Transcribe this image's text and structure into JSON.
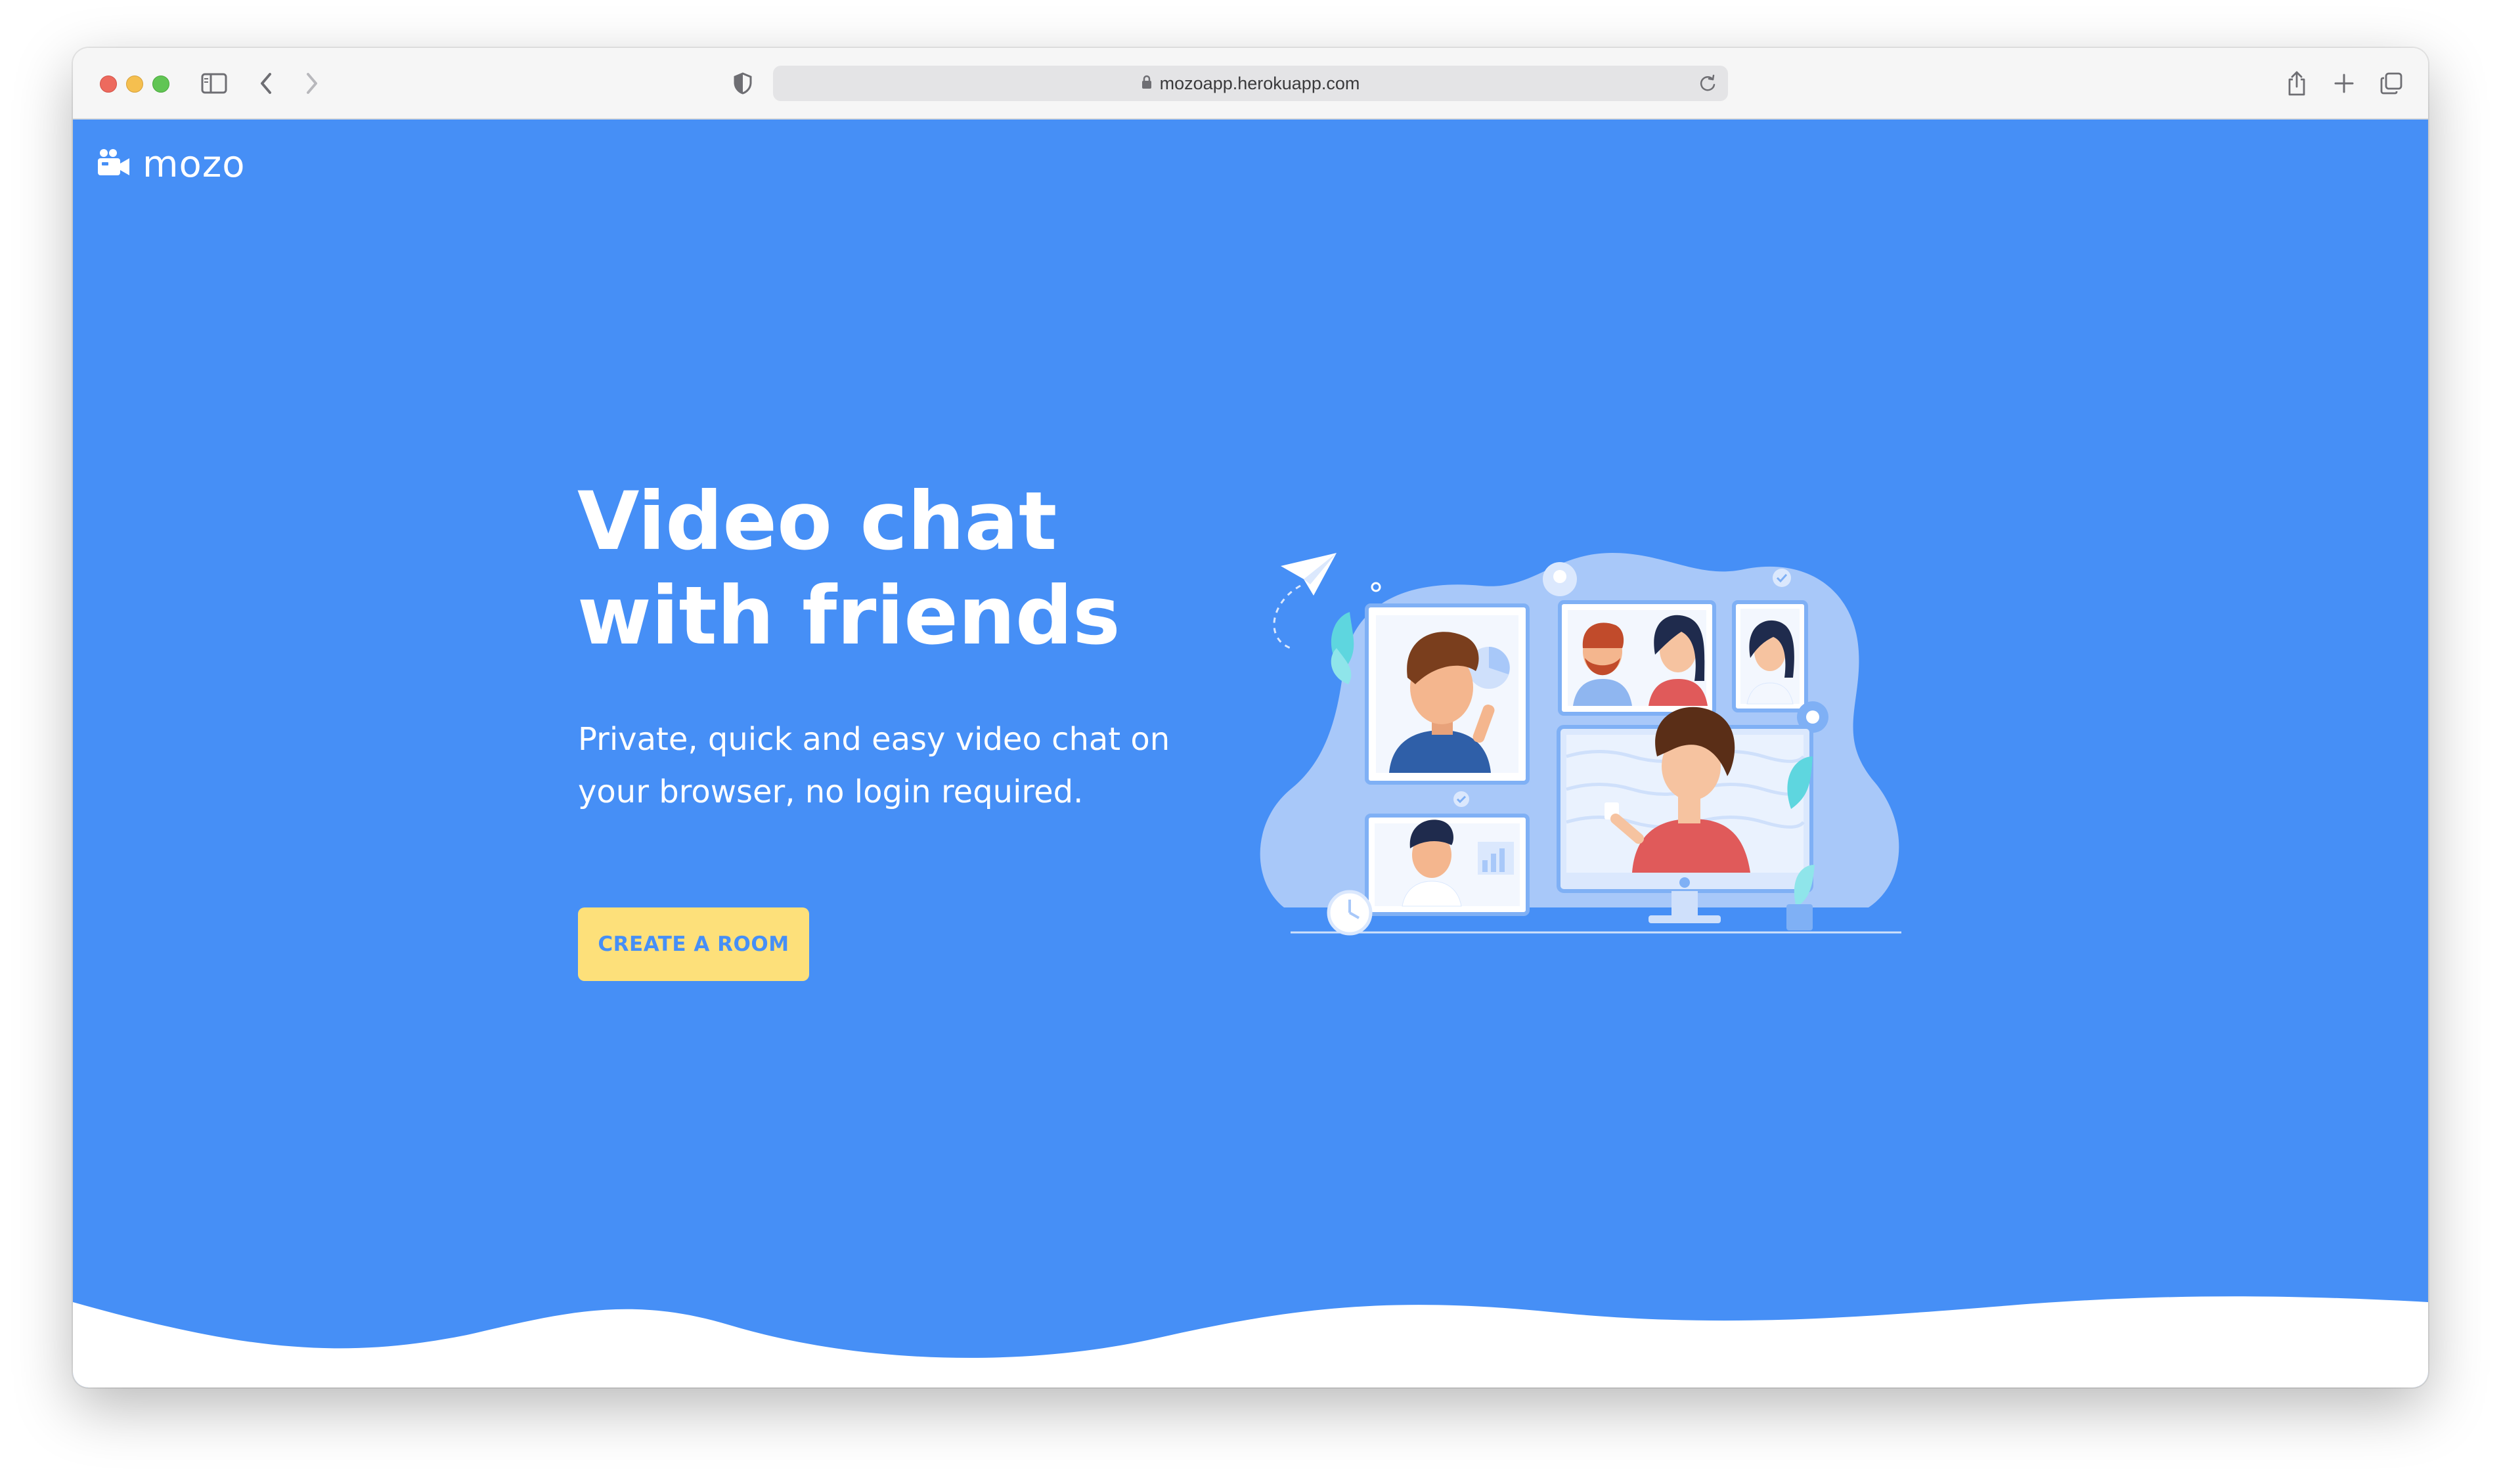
{
  "browser": {
    "url": "mozoapp.herokuapp.com",
    "icons": {
      "close": "traffic-light-close",
      "minimize": "traffic-light-minimize",
      "zoom": "traffic-light-zoom",
      "sidebar": "sidebar-icon",
      "back": "chevron-left-icon",
      "forward": "chevron-right-icon",
      "privacy": "shield-icon",
      "lock": "lock-icon",
      "reload": "reload-icon",
      "share": "share-icon",
      "new_tab": "plus-icon",
      "tabs": "tabs-overview-icon"
    }
  },
  "site": {
    "logo_text": "mozo",
    "logo_icon": "video-camera-icon"
  },
  "hero": {
    "headline_line1": "Video chat",
    "headline_line2": "with friends",
    "subtitle_line1": "Private, quick and easy video chat on",
    "subtitle_line2": "your browser, no login required.",
    "cta_label": "CREATE A ROOM"
  },
  "colors": {
    "background": "#468ff6",
    "cta_background": "#fde07a",
    "cta_text": "#468ff6",
    "text": "#ffffff"
  }
}
